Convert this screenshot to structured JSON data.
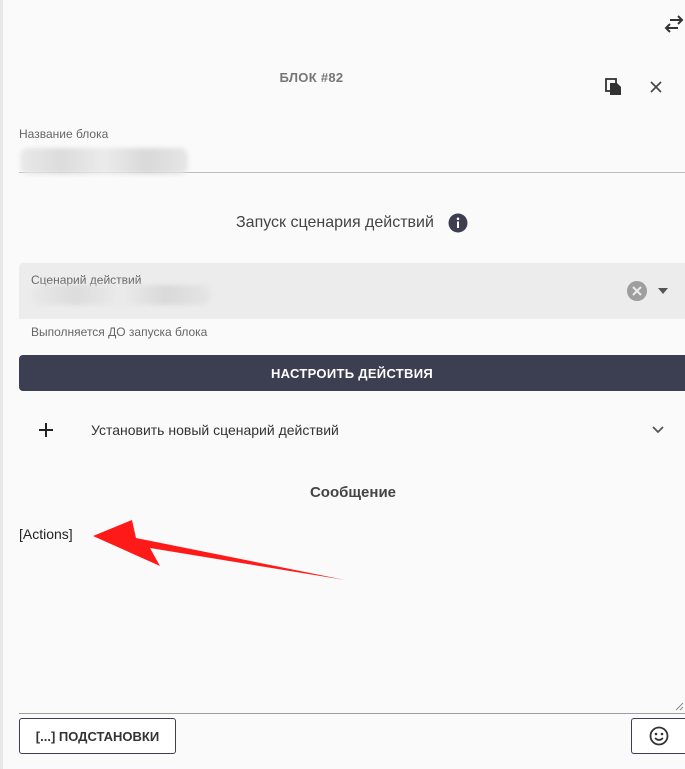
{
  "header": {
    "title": "БЛОК #82",
    "swap_icon": "swap-horizontal-icon",
    "copy_icon": "copy-icon",
    "close_icon": "close-icon"
  },
  "block_name": {
    "label": "Название блока",
    "value": ""
  },
  "scenario_section": {
    "title": "Запуск сценария действий",
    "field_label": "Сценарий действий",
    "field_value": "",
    "hint": "Выполняется ДО запуска блока",
    "configure_button": "НАСТРОИТЬ ДЕЙСТВИЯ",
    "new_scenario_label": "Установить новый сценарий действий"
  },
  "message": {
    "title": "Сообщение",
    "text": "[Actions]"
  },
  "footer": {
    "substitutions_button": "[...] ПОДСТАНОВКИ",
    "emoji_icon": "emoji-smile-icon"
  },
  "colors": {
    "primary_button": "#3c3f52",
    "background": "#fafafa",
    "field_background": "#ececec",
    "annotation_arrow": "#ff1a1a"
  }
}
